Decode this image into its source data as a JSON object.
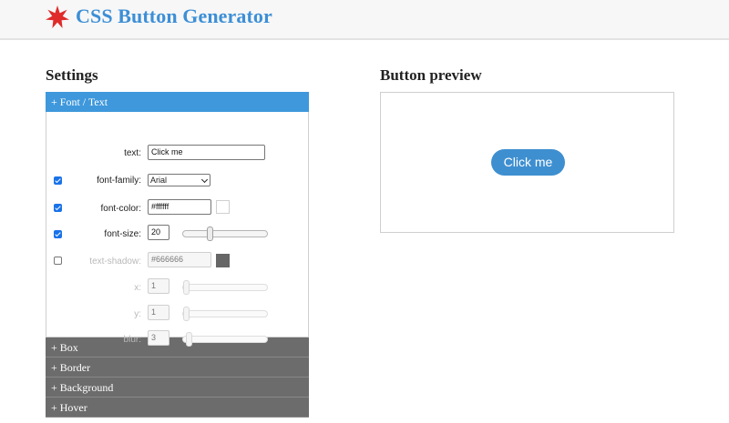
{
  "header": {
    "title": "CSS Button Generator",
    "logo_icon": "red-star-icon",
    "title_color": "#3d8fd6"
  },
  "settings": {
    "title": "Settings",
    "sections": [
      {
        "label": "+ Font / Text",
        "expanded": true
      },
      {
        "label": "+ Box",
        "expanded": false
      },
      {
        "label": "+ Border",
        "expanded": false
      },
      {
        "label": "+ Background",
        "expanded": false
      },
      {
        "label": "+ Hover",
        "expanded": false
      }
    ],
    "font_text": {
      "text": {
        "label": "text:",
        "value": "Click me"
      },
      "font_family": {
        "label": "font-family:",
        "checked": true,
        "value": "Arial"
      },
      "font_color": {
        "label": "font-color:",
        "checked": true,
        "value": "#ffffff",
        "swatch": "#ffffff"
      },
      "font_size": {
        "label": "font-size:",
        "checked": true,
        "value": "20",
        "slider_fraction": 0.3
      },
      "text_shadow": {
        "label": "text-shadow:",
        "checked": false,
        "value": "#666666",
        "swatch": "#666666"
      },
      "x": {
        "label": "x:",
        "value": "1",
        "slider_fraction": 0.0
      },
      "y": {
        "label": "y:",
        "value": "1",
        "slider_fraction": 0.0
      },
      "blur": {
        "label": "blur:",
        "value": "3",
        "slider_fraction": 0.03
      }
    }
  },
  "preview": {
    "title": "Button preview",
    "button_label": "Click me",
    "button_color": "#3e8fd0"
  },
  "colors": {
    "accent": "#3e98db",
    "collapsed_header": "#6c6c6c"
  }
}
